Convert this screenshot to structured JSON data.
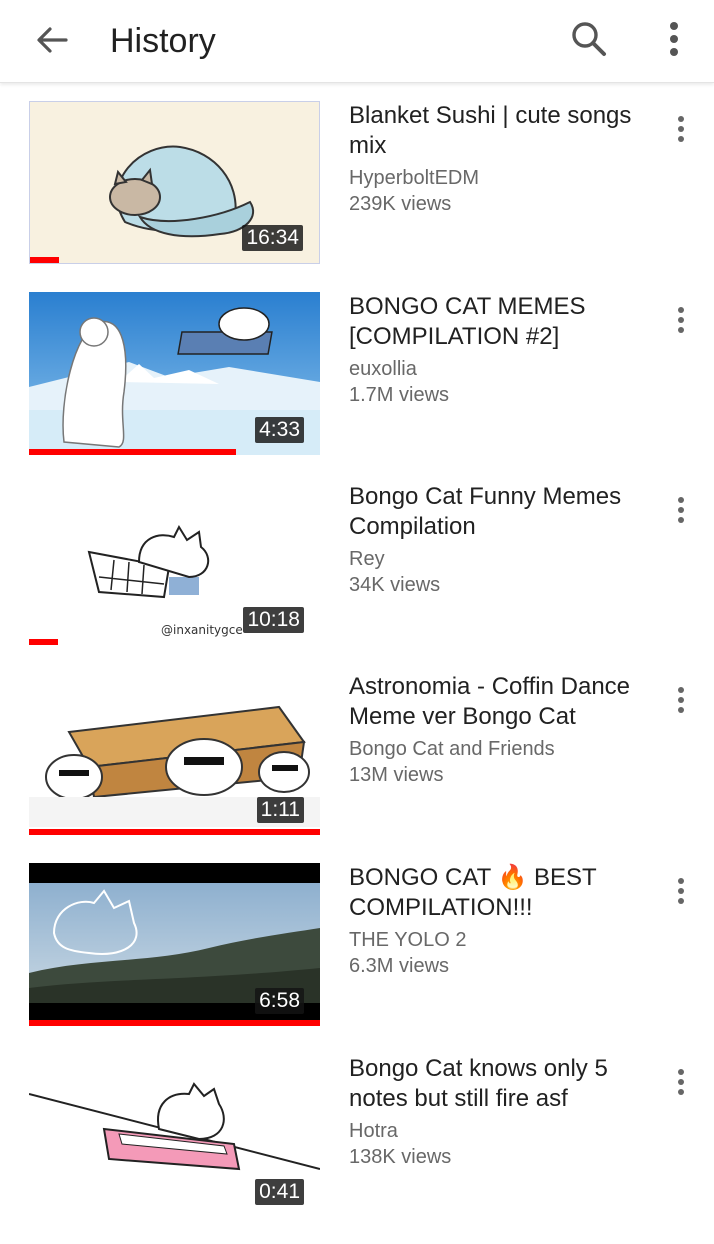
{
  "header": {
    "title": "History",
    "back_icon": "arrow-back-icon",
    "search_icon": "search-icon",
    "more_icon": "more-vert-icon"
  },
  "videos": [
    {
      "title": "Blanket Sushi | cute songs mix",
      "channel": "HyperboltEDM",
      "views": "239K views",
      "duration": "16:34",
      "watched_fraction": 0.1
    },
    {
      "title": "BONGO CAT MEMES [COMPILATION #2]",
      "channel": "euxollia",
      "views": "1.7M views",
      "duration": "4:33",
      "watched_fraction": 0.71
    },
    {
      "title": "Bongo Cat Funny Memes Compilation",
      "channel": "Rey",
      "views": "34K views",
      "duration": "10:18",
      "watched_fraction": 0.1
    },
    {
      "title": "Astronomia - Coffin Dance Meme ver Bongo Cat",
      "channel": "Bongo Cat and Friends",
      "views": "13M views",
      "duration": "1:11",
      "watched_fraction": 1.0
    },
    {
      "title_before_emoji": "BONGO CAT",
      "title_emoji": "🔥",
      "title_after_emoji": "BEST COMPILATION!!!",
      "channel": "THE YOLO 2",
      "views": "6.3M views",
      "duration": "6:58",
      "watched_fraction": 1.0
    },
    {
      "title": "Bongo Cat knows only 5 notes but still fire asf",
      "channel": "Hotra",
      "views": "138K views",
      "duration": "0:41",
      "watched_fraction": 0
    }
  ],
  "colors": {
    "progress": "#ff0000",
    "secondary_text": "#686868",
    "primary_text": "#212121"
  }
}
